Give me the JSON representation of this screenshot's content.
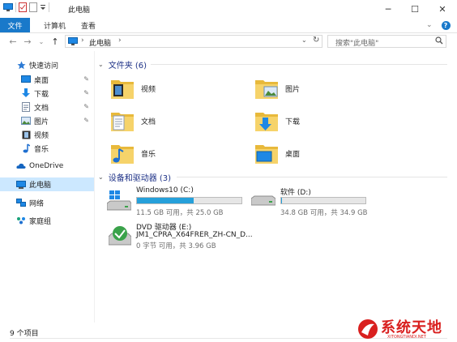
{
  "window": {
    "title": "此电脑",
    "controls": {
      "minimize": "─",
      "maximize": "☐",
      "close": "✕"
    }
  },
  "ribbon": {
    "tabs": [
      {
        "label": "文件",
        "active": true
      },
      {
        "label": "计算机"
      },
      {
        "label": "查看"
      }
    ],
    "help": "?"
  },
  "address_bar": {
    "path": [
      "此电脑"
    ],
    "search_placeholder": "搜索\"此电脑\""
  },
  "nav_pane": {
    "quick_access": "快速访问",
    "items": [
      {
        "label": "桌面",
        "icon": "desktop-icon",
        "pinned": true
      },
      {
        "label": "下载",
        "icon": "download-icon",
        "pinned": true
      },
      {
        "label": "文档",
        "icon": "document-icon",
        "pinned": true
      },
      {
        "label": "图片",
        "icon": "pictures-icon",
        "pinned": true
      },
      {
        "label": "视频",
        "icon": "video-icon"
      },
      {
        "label": "音乐",
        "icon": "music-icon"
      }
    ],
    "onedrive": "OneDrive",
    "this_pc": "此电脑",
    "network": "网络",
    "homegroup": "家庭组"
  },
  "folders_group": {
    "header": "文件夹 (6)",
    "items": [
      {
        "label": "视频",
        "icon": "video-folder-icon"
      },
      {
        "label": "图片",
        "icon": "pictures-folder-icon"
      },
      {
        "label": "文档",
        "icon": "documents-folder-icon"
      },
      {
        "label": "下载",
        "icon": "downloads-folder-icon"
      },
      {
        "label": "音乐",
        "icon": "music-folder-icon"
      },
      {
        "label": "桌面",
        "icon": "desktop-folder-icon"
      }
    ]
  },
  "devices_group": {
    "header": "设备和驱动器 (3)",
    "drives": [
      {
        "name": "Windows10 (C:)",
        "info": "11.5 GB 可用，共 25.0 GB",
        "used_fraction": 0.54,
        "icon": "windows-drive-icon"
      },
      {
        "name": "软件 (D:)",
        "info": "34.8 GB 可用，共 34.9 GB",
        "used_fraction": 0.003,
        "icon": "hard-drive-icon"
      }
    ],
    "dvd": {
      "name": "DVD 驱动器 (E:)",
      "label": "JM1_CPRA_X64FRER_ZH-CN_D...",
      "info": "0 字节 可用，共 3.96 GB",
      "icon": "dvd-drive-icon"
    }
  },
  "status_bar": {
    "count": "9 个项目"
  },
  "watermark": {
    "text": "系统天地",
    "url_text": "XITONGTIANDI.NET"
  },
  "colors": {
    "accent": "#1979ca",
    "selection": "#cce8ff",
    "bar_fill": "#26a0da",
    "header_text": "#1e3287",
    "watermark_red": "#d9201f"
  }
}
